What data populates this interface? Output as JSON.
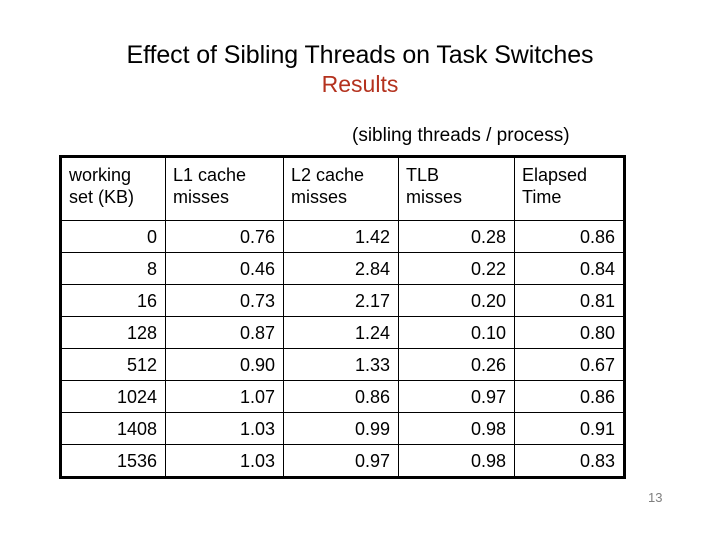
{
  "slide": {
    "title_main": "Effect of Sibling Threads on Task Switches",
    "title_sub": "Results",
    "title_sub_color": "#B4321E",
    "caption": "(sibling threads / process)",
    "page_number": "13",
    "page_number_color": "#7F7F7F",
    "background_color": "#FFFFFF",
    "text_color": "#000000",
    "table_border_color": "#000000"
  },
  "table": {
    "headers": [
      {
        "line1": "working",
        "line2": "set (KB)"
      },
      {
        "line1": "L1 cache",
        "line2": "misses"
      },
      {
        "line1": "L2 cache",
        "line2": "misses"
      },
      {
        "line1": "TLB",
        "line2": "misses"
      },
      {
        "line1": "Elapsed",
        "line2": "Time"
      }
    ],
    "rows": [
      {
        "working_set_kb": "0",
        "l1_cache_misses": "0.76",
        "l2_cache_misses": "1.42",
        "tlb_misses": "0.28",
        "elapsed_time": "0.86"
      },
      {
        "working_set_kb": "8",
        "l1_cache_misses": "0.46",
        "l2_cache_misses": "2.84",
        "tlb_misses": "0.22",
        "elapsed_time": "0.84"
      },
      {
        "working_set_kb": "16",
        "l1_cache_misses": "0.73",
        "l2_cache_misses": "2.17",
        "tlb_misses": "0.20",
        "elapsed_time": "0.81"
      },
      {
        "working_set_kb": "128",
        "l1_cache_misses": "0.87",
        "l2_cache_misses": "1.24",
        "tlb_misses": "0.10",
        "elapsed_time": "0.80"
      },
      {
        "working_set_kb": "512",
        "l1_cache_misses": "0.90",
        "l2_cache_misses": "1.33",
        "tlb_misses": "0.26",
        "elapsed_time": "0.67"
      },
      {
        "working_set_kb": "1024",
        "l1_cache_misses": "1.07",
        "l2_cache_misses": "0.86",
        "tlb_misses": "0.97",
        "elapsed_time": "0.86"
      },
      {
        "working_set_kb": "1408",
        "l1_cache_misses": "1.03",
        "l2_cache_misses": "0.99",
        "tlb_misses": "0.98",
        "elapsed_time": "0.91"
      },
      {
        "working_set_kb": "1536",
        "l1_cache_misses": "1.03",
        "l2_cache_misses": "0.97",
        "tlb_misses": "0.98",
        "elapsed_time": "0.83"
      }
    ]
  },
  "chart_data": {
    "type": "table",
    "title": "Effect of Sibling Threads on Task Switches — Results",
    "subtitle": "(sibling threads / process)",
    "columns": [
      "working set (KB)",
      "L1 cache misses",
      "L2 cache misses",
      "TLB misses",
      "Elapsed Time"
    ],
    "x": [
      0,
      8,
      16,
      128,
      512,
      1024,
      1408,
      1536
    ],
    "xlabel": "working set (KB)",
    "ylabel": "ratio (sibling threads / process)",
    "series": [
      {
        "name": "L1 cache misses",
        "values": [
          0.76,
          0.46,
          0.73,
          0.87,
          0.9,
          1.07,
          1.03,
          1.03
        ]
      },
      {
        "name": "L2 cache misses",
        "values": [
          1.42,
          2.84,
          2.17,
          1.24,
          1.33,
          0.86,
          0.99,
          0.97
        ]
      },
      {
        "name": "TLB misses",
        "values": [
          0.28,
          0.22,
          0.2,
          0.1,
          0.26,
          0.97,
          0.98,
          0.98
        ]
      },
      {
        "name": "Elapsed Time",
        "values": [
          0.86,
          0.84,
          0.81,
          0.8,
          0.67,
          0.86,
          0.91,
          0.83
        ]
      }
    ],
    "grid": true,
    "legend": "none"
  }
}
